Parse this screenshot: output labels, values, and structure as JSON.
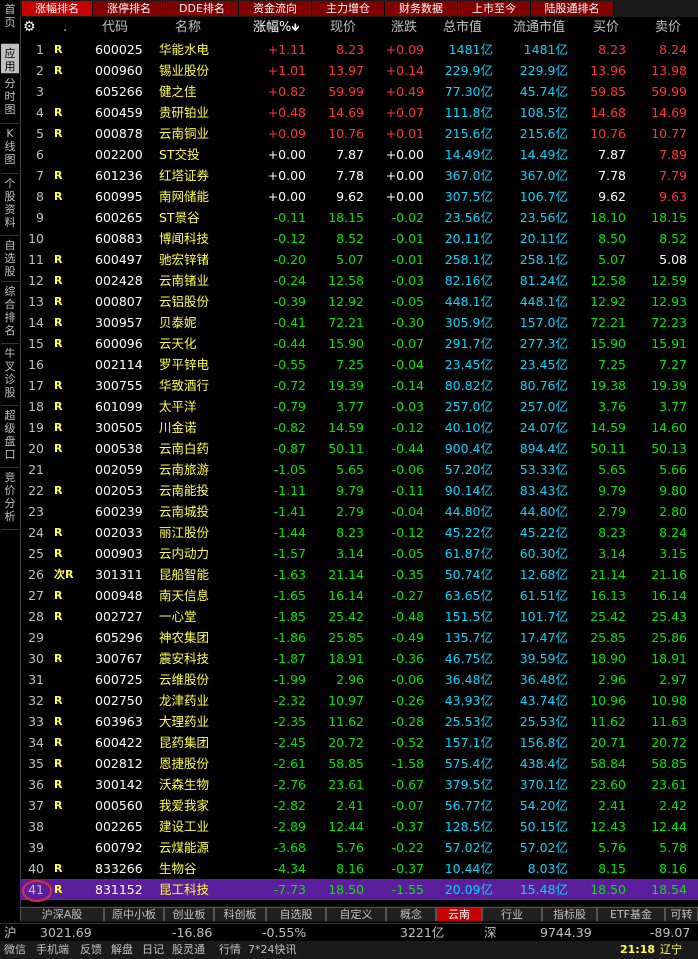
{
  "sidebar": {
    "items": [
      "首页",
      "应用",
      "分时图",
      "K线图",
      "个股资料",
      "自选股",
      "综合排名",
      "牛叉诊股",
      "超级盘口",
      "竞价分析"
    ]
  },
  "top_tabs": [
    "涨幅排名",
    "涨停排名",
    "DDE排名",
    "资金流向",
    "主力增仓",
    "财务数据",
    "上市至今",
    "陆股通排名"
  ],
  "header": {
    "dot": ".",
    "code": "代码",
    "name": "名称",
    "change_pct": "涨幅%",
    "price": "现价",
    "change": "涨跌",
    "total_mv": "总市值",
    "float_mv": "流通市值",
    "bid": "买价",
    "ask": "卖价"
  },
  "rows": [
    {
      "i": "1",
      "flag": "R",
      "code": "600025",
      "name": "华能水电",
      "pct": "+1.11",
      "price": "8.23",
      "chg": "+0.09",
      "tmv": "1481",
      "fmv": "1481",
      "bid": "8.23",
      "ask": "8.24",
      "dir": "red"
    },
    {
      "i": "2",
      "flag": "R",
      "code": "000960",
      "name": "锡业股份",
      "pct": "+1.01",
      "price": "13.97",
      "chg": "+0.14",
      "tmv": "229.9",
      "fmv": "229.9",
      "bid": "13.96",
      "ask": "13.98",
      "dir": "red"
    },
    {
      "i": "3",
      "flag": "",
      "code": "605266",
      "name": "健之佳",
      "pct": "+0.82",
      "price": "59.99",
      "chg": "+0.49",
      "tmv": "77.30",
      "fmv": "45.74",
      "bid": "59.85",
      "ask": "59.99",
      "dir": "red"
    },
    {
      "i": "4",
      "flag": "R",
      "code": "600459",
      "name": "贵研铂业",
      "pct": "+0.48",
      "price": "14.69",
      "chg": "+0.07",
      "tmv": "111.8",
      "fmv": "108.5",
      "bid": "14.68",
      "ask": "14.69",
      "dir": "red"
    },
    {
      "i": "5",
      "flag": "R",
      "code": "000878",
      "name": "云南铜业",
      "pct": "+0.09",
      "price": "10.76",
      "chg": "+0.01",
      "tmv": "215.6",
      "fmv": "215.6",
      "bid": "10.76",
      "ask": "10.77",
      "dir": "red"
    },
    {
      "i": "6",
      "flag": "",
      "code": "002200",
      "name": "ST交投",
      "pct": "+0.00",
      "price": "7.87",
      "chg": "+0.00",
      "tmv": "14.49",
      "fmv": "14.49",
      "bid": "7.87",
      "ask": "7.89",
      "dir": "white",
      "askdir": "red"
    },
    {
      "i": "7",
      "flag": "R",
      "code": "601236",
      "name": "红塔证券",
      "pct": "+0.00",
      "price": "7.78",
      "chg": "+0.00",
      "tmv": "367.0",
      "fmv": "367.0",
      "bid": "7.78",
      "ask": "7.79",
      "dir": "white",
      "askdir": "red"
    },
    {
      "i": "8",
      "flag": "R",
      "code": "600995",
      "name": "南网储能",
      "pct": "+0.00",
      "price": "9.62",
      "chg": "+0.00",
      "tmv": "307.5",
      "fmv": "106.7",
      "bid": "9.62",
      "ask": "9.63",
      "dir": "white",
      "askdir": "red"
    },
    {
      "i": "9",
      "flag": "",
      "code": "600265",
      "name": "ST景谷",
      "pct": "-0.11",
      "price": "18.15",
      "chg": "-0.02",
      "tmv": "23.56",
      "fmv": "23.56",
      "bid": "18.10",
      "ask": "18.15",
      "dir": "green"
    },
    {
      "i": "10",
      "flag": "",
      "code": "600883",
      "name": "博闻科技",
      "pct": "-0.12",
      "price": "8.52",
      "chg": "-0.01",
      "tmv": "20.11",
      "fmv": "20.11",
      "bid": "8.50",
      "ask": "8.52",
      "dir": "green"
    },
    {
      "i": "11",
      "flag": "R",
      "code": "600497",
      "name": "驰宏锌锗",
      "pct": "-0.20",
      "price": "5.07",
      "chg": "-0.01",
      "tmv": "258.1",
      "fmv": "258.1",
      "bid": "5.07",
      "ask": "5.08",
      "dir": "green",
      "askdir": "white"
    },
    {
      "i": "12",
      "flag": "R",
      "code": "002428",
      "name": "云南锗业",
      "pct": "-0.24",
      "price": "12.58",
      "chg": "-0.03",
      "tmv": "82.16",
      "fmv": "81.24",
      "bid": "12.58",
      "ask": "12.59",
      "dir": "green"
    },
    {
      "i": "13",
      "flag": "R",
      "code": "000807",
      "name": "云铝股份",
      "pct": "-0.39",
      "price": "12.92",
      "chg": "-0.05",
      "tmv": "448.1",
      "fmv": "448.1",
      "bid": "12.92",
      "ask": "12.93",
      "dir": "green"
    },
    {
      "i": "14",
      "flag": "R",
      "code": "300957",
      "name": "贝泰妮",
      "pct": "-0.41",
      "price": "72.21",
      "chg": "-0.30",
      "tmv": "305.9",
      "fmv": "157.0",
      "bid": "72.21",
      "ask": "72.23",
      "dir": "green"
    },
    {
      "i": "15",
      "flag": "R",
      "code": "600096",
      "name": "云天化",
      "pct": "-0.44",
      "price": "15.90",
      "chg": "-0.07",
      "tmv": "291.7",
      "fmv": "277.3",
      "bid": "15.90",
      "ask": "15.91",
      "dir": "green"
    },
    {
      "i": "16",
      "flag": "",
      "code": "002114",
      "name": "罗平锌电",
      "pct": "-0.55",
      "price": "7.25",
      "chg": "-0.04",
      "tmv": "23.45",
      "fmv": "23.45",
      "bid": "7.25",
      "ask": "7.27",
      "dir": "green"
    },
    {
      "i": "17",
      "flag": "R",
      "code": "300755",
      "name": "华致酒行",
      "pct": "-0.72",
      "price": "19.39",
      "chg": "-0.14",
      "tmv": "80.82",
      "fmv": "80.76",
      "bid": "19.38",
      "ask": "19.39",
      "dir": "green"
    },
    {
      "i": "18",
      "flag": "R",
      "code": "601099",
      "name": "太平洋",
      "pct": "-0.79",
      "price": "3.77",
      "chg": "-0.03",
      "tmv": "257.0",
      "fmv": "257.0",
      "bid": "3.76",
      "ask": "3.77",
      "dir": "green"
    },
    {
      "i": "19",
      "flag": "R",
      "code": "300505",
      "name": "川金诺",
      "pct": "-0.82",
      "price": "14.59",
      "chg": "-0.12",
      "tmv": "40.10",
      "fmv": "24.07",
      "bid": "14.59",
      "ask": "14.60",
      "dir": "green"
    },
    {
      "i": "20",
      "flag": "R",
      "code": "000538",
      "name": "云南白药",
      "pct": "-0.87",
      "price": "50.11",
      "chg": "-0.44",
      "tmv": "900.4",
      "fmv": "894.4",
      "bid": "50.11",
      "ask": "50.13",
      "dir": "green"
    },
    {
      "i": "21",
      "flag": "",
      "code": "002059",
      "name": "云南旅游",
      "pct": "-1.05",
      "price": "5.65",
      "chg": "-0.06",
      "tmv": "57.20",
      "fmv": "53.33",
      "bid": "5.65",
      "ask": "5.66",
      "dir": "green"
    },
    {
      "i": "22",
      "flag": "R",
      "code": "002053",
      "name": "云南能投",
      "pct": "-1.11",
      "price": "9.79",
      "chg": "-0.11",
      "tmv": "90.14",
      "fmv": "83.43",
      "bid": "9.79",
      "ask": "9.80",
      "dir": "green"
    },
    {
      "i": "23",
      "flag": "",
      "code": "600239",
      "name": "云南城投",
      "pct": "-1.41",
      "price": "2.79",
      "chg": "-0.04",
      "tmv": "44.80",
      "fmv": "44.80",
      "bid": "2.79",
      "ask": "2.80",
      "dir": "green"
    },
    {
      "i": "24",
      "flag": "R",
      "code": "002033",
      "name": "丽江股份",
      "pct": "-1.44",
      "price": "8.23",
      "chg": "-0.12",
      "tmv": "45.22",
      "fmv": "45.22",
      "bid": "8.23",
      "ask": "8.24",
      "dir": "green"
    },
    {
      "i": "25",
      "flag": "R",
      "code": "000903",
      "name": "云内动力",
      "pct": "-1.57",
      "price": "3.14",
      "chg": "-0.05",
      "tmv": "61.87",
      "fmv": "60.30",
      "bid": "3.14",
      "ask": "3.15",
      "dir": "green"
    },
    {
      "i": "26",
      "flag": "次R",
      "code": "301311",
      "name": "昆船智能",
      "pct": "-1.63",
      "price": "21.14",
      "chg": "-0.35",
      "tmv": "50.74",
      "fmv": "12.68",
      "bid": "21.14",
      "ask": "21.16",
      "dir": "green"
    },
    {
      "i": "27",
      "flag": "R",
      "code": "000948",
      "name": "南天信息",
      "pct": "-1.65",
      "price": "16.14",
      "chg": "-0.27",
      "tmv": "63.65",
      "fmv": "61.51",
      "bid": "16.13",
      "ask": "16.14",
      "dir": "green"
    },
    {
      "i": "28",
      "flag": "R",
      "code": "002727",
      "name": "一心堂",
      "pct": "-1.85",
      "price": "25.42",
      "chg": "-0.48",
      "tmv": "151.5",
      "fmv": "101.7",
      "bid": "25.42",
      "ask": "25.43",
      "dir": "green"
    },
    {
      "i": "29",
      "flag": "",
      "code": "605296",
      "name": "神农集团",
      "pct": "-1.86",
      "price": "25.85",
      "chg": "-0.49",
      "tmv": "135.7",
      "fmv": "17.47",
      "bid": "25.85",
      "ask": "25.86",
      "dir": "green"
    },
    {
      "i": "30",
      "flag": "R",
      "code": "300767",
      "name": "震安科技",
      "pct": "-1.87",
      "price": "18.91",
      "chg": "-0.36",
      "tmv": "46.75",
      "fmv": "39.59",
      "bid": "18.90",
      "ask": "18.91",
      "dir": "green"
    },
    {
      "i": "31",
      "flag": "",
      "code": "600725",
      "name": "云维股份",
      "pct": "-1.99",
      "price": "2.96",
      "chg": "-0.06",
      "tmv": "36.48",
      "fmv": "36.48",
      "bid": "2.96",
      "ask": "2.97",
      "dir": "green"
    },
    {
      "i": "32",
      "flag": "R",
      "code": "002750",
      "name": "龙津药业",
      "pct": "-2.32",
      "price": "10.97",
      "chg": "-0.26",
      "tmv": "43.93",
      "fmv": "43.74",
      "bid": "10.96",
      "ask": "10.98",
      "dir": "green"
    },
    {
      "i": "33",
      "flag": "R",
      "code": "603963",
      "name": "大理药业",
      "pct": "-2.35",
      "price": "11.62",
      "chg": "-0.28",
      "tmv": "25.53",
      "fmv": "25.53",
      "bid": "11.62",
      "ask": "11.63",
      "dir": "green"
    },
    {
      "i": "34",
      "flag": "R",
      "code": "600422",
      "name": "昆药集团",
      "pct": "-2.45",
      "price": "20.72",
      "chg": "-0.52",
      "tmv": "157.1",
      "fmv": "156.8",
      "bid": "20.71",
      "ask": "20.72",
      "dir": "green"
    },
    {
      "i": "35",
      "flag": "R",
      "code": "002812",
      "name": "恩捷股份",
      "pct": "-2.61",
      "price": "58.85",
      "chg": "-1.58",
      "tmv": "575.4",
      "fmv": "438.4",
      "bid": "58.84",
      "ask": "58.85",
      "dir": "green"
    },
    {
      "i": "36",
      "flag": "R",
      "code": "300142",
      "name": "沃森生物",
      "pct": "-2.76",
      "price": "23.61",
      "chg": "-0.67",
      "tmv": "379.5",
      "fmv": "370.1",
      "bid": "23.60",
      "ask": "23.61",
      "dir": "green"
    },
    {
      "i": "37",
      "flag": "R",
      "code": "000560",
      "name": "我爱我家",
      "pct": "-2.82",
      "price": "2.41",
      "chg": "-0.07",
      "tmv": "56.77",
      "fmv": "54.20",
      "bid": "2.41",
      "ask": "2.42",
      "dir": "green"
    },
    {
      "i": "38",
      "flag": "",
      "code": "002265",
      "name": "建设工业",
      "pct": "-2.89",
      "price": "12.44",
      "chg": "-0.37",
      "tmv": "128.5",
      "fmv": "50.15",
      "bid": "12.43",
      "ask": "12.44",
      "dir": "green"
    },
    {
      "i": "39",
      "flag": "",
      "code": "600792",
      "name": "云煤能源",
      "pct": "-3.68",
      "price": "5.76",
      "chg": "-0.22",
      "tmv": "57.02",
      "fmv": "57.02",
      "bid": "5.76",
      "ask": "5.78",
      "dir": "green"
    },
    {
      "i": "40",
      "flag": "R",
      "code": "833266",
      "name": "生物谷",
      "pct": "-4.34",
      "price": "8.16",
      "chg": "-0.37",
      "tmv": "10.44",
      "fmv": "8.03",
      "bid": "8.15",
      "ask": "8.16",
      "dir": "green"
    },
    {
      "i": "41",
      "flag": "R",
      "code": "831152",
      "name": "昆工科技",
      "pct": "-7.73",
      "price": "18.50",
      "chg": "-1.55",
      "tmv": "20.09",
      "fmv": "15.48",
      "bid": "18.50",
      "ask": "18.54",
      "dir": "green"
    }
  ],
  "unit_yi": "亿",
  "bottom_tabs": [
    "沪深A股",
    "原中小板",
    "创业板",
    "科创板",
    "自选股",
    "自定义",
    "概念",
    "云南",
    "行业",
    "指标股",
    "ETF基金",
    "可转"
  ],
  "status": {
    "sh_label": "沪",
    "sh_index": "3021.69",
    "sh_change": "-16.86",
    "sh_pct": "-0.55%",
    "sh_amount": "3221亿",
    "sz_label": "深",
    "sz_index": "9744.39",
    "sz_change": "-89.07"
  },
  "footer": {
    "items": [
      "微信",
      "手机端",
      "反馈",
      "解盘",
      "日记",
      "股灵通",
      "行情",
      "7*24快讯"
    ],
    "time": "21:18",
    "location": "辽宁"
  },
  "colors": {
    "up": "#ff3232",
    "down": "#00e600",
    "flat": "#ffffff",
    "name": "#ffff44",
    "unit": "#00d7ff",
    "selected_row": "#5b1e9c"
  }
}
